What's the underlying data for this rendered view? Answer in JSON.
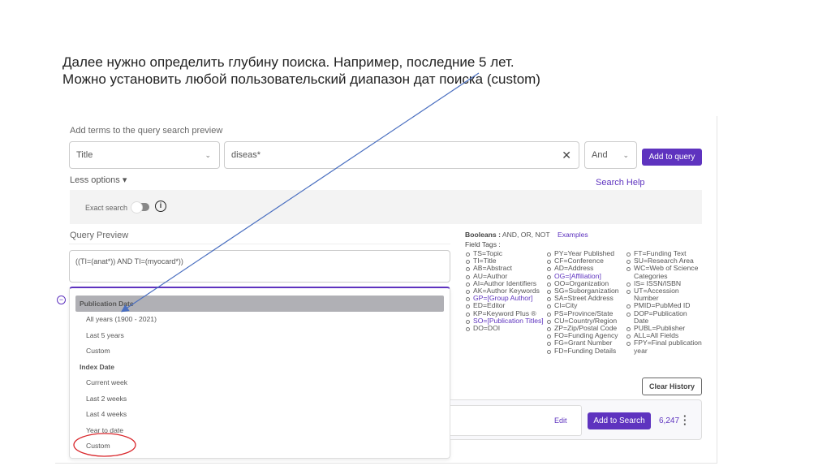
{
  "heading": {
    "line1": "Далее нужно определить глубину поиска. Например, последние 5 лет.",
    "line2": "Можно установить любой пользовательский диапазон дат поиска (custom)"
  },
  "builder": {
    "label": "Add terms to the query search preview",
    "field": "Title",
    "term": "diseas*",
    "operator": "And",
    "add_button": "Add to query",
    "less_options": "Less options",
    "search_help": "Search Help",
    "exact_search": "Exact search"
  },
  "preview": {
    "label": "Query Preview",
    "query": "((TI=(anat*)) AND TI=(myocard*))"
  },
  "dropdown": {
    "groups": [
      {
        "label": "Publication Date",
        "items": [
          "All years (1900 - 2021)",
          "Last 5 years",
          "Custom"
        ]
      },
      {
        "label": "Index Date",
        "items": [
          "Current week",
          "Last 2 weeks",
          "Last 4 weeks",
          "Year to date",
          "Custom"
        ]
      }
    ]
  },
  "help": {
    "booleans_label": "Booleans :",
    "booleans": "AND, OR, NOT",
    "examples": "Examples",
    "field_tags_label": "Field Tags :",
    "col1": [
      "TS=Topic",
      "TI=Title",
      "AB=Abstract",
      "AU=Author",
      "AI=Author Identifiers",
      "AK=Author Keywords",
      "GP=[Group Author]",
      "ED=Editor",
      "KP=Keyword Plus ®",
      "SO=[Publication Titles]",
      "DO=DOI"
    ],
    "col2": [
      "PY=Year Published",
      "CF=Conference",
      "AD=Address",
      "OG=[Affiliation]",
      "OO=Organization",
      "SG=Suborganization",
      "SA=Street Address",
      "CI=City",
      "PS=Province/State",
      "CU=Country/Region",
      "ZP=Zip/Postal Code",
      "FO=Funding Agency",
      "FG=Grant Number",
      "FD=Funding Details"
    ],
    "col3": [
      "FT=Funding Text",
      "SU=Research Area",
      "WC=Web of Science Categories",
      "IS= ISSN/ISBN",
      "UT=Accession Number",
      "PMID=PubMed ID",
      "DOP=Publication Date",
      "PUBL=Publisher",
      "ALL=All Fields",
      "FPY=Final publication year"
    ]
  },
  "history": {
    "clear": "Clear History",
    "edit": "Edit",
    "add_to_search": "Add to Search",
    "count": "6,247"
  },
  "colors": {
    "accent": "#5e33bf",
    "arrow": "#4a6fc0",
    "circle": "#d9262b"
  }
}
